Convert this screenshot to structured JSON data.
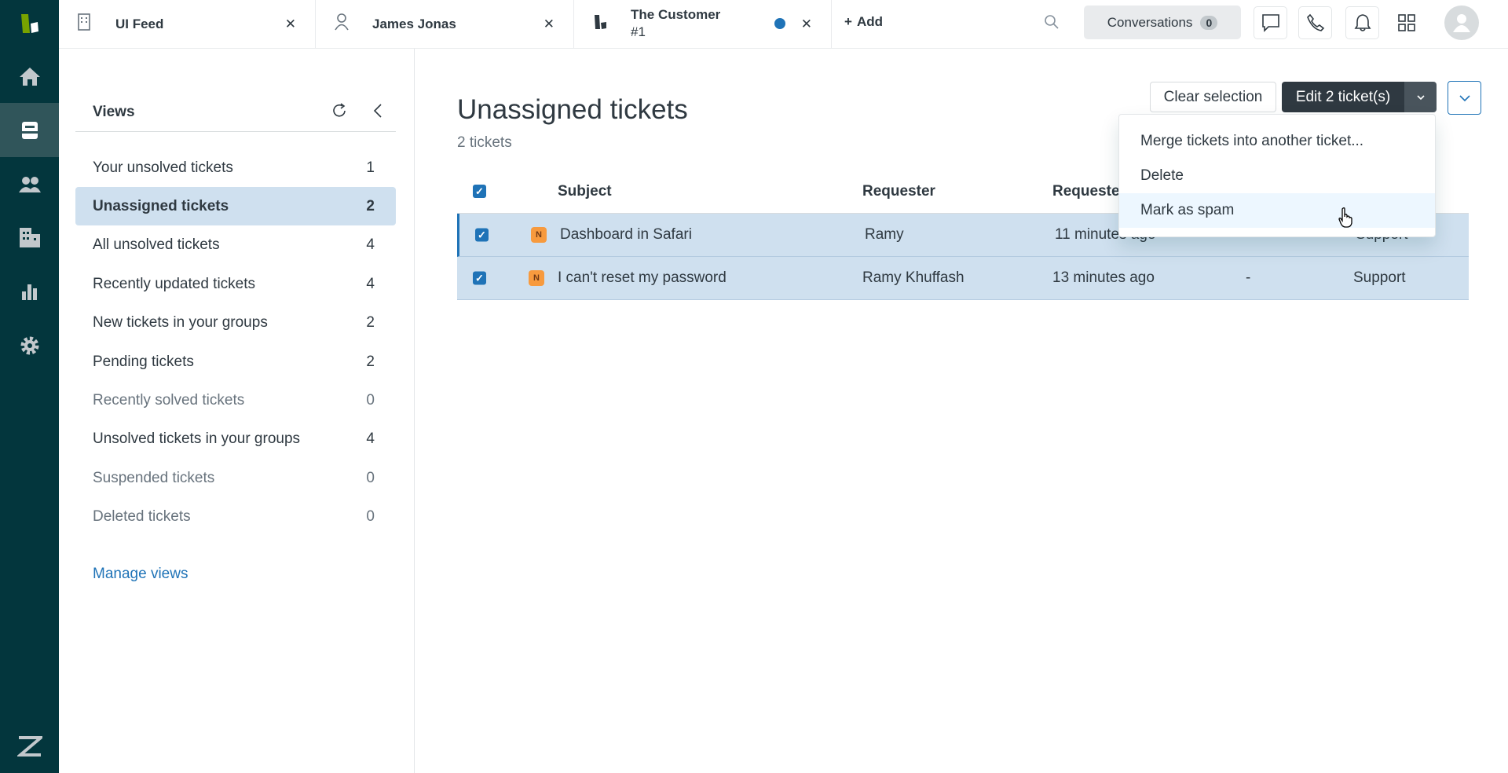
{
  "tabs": [
    {
      "label": "UI Feed",
      "icon": "building-icon"
    },
    {
      "label": "James Jonas",
      "icon": "user-icon"
    },
    {
      "label": "The Customer",
      "sublabel": "#1",
      "icon": "zendesk-icon",
      "unread": true
    }
  ],
  "add_label": "Add",
  "conversations": {
    "label": "Conversations",
    "count": "0"
  },
  "views": {
    "title": "Views",
    "items": [
      {
        "label": "Your unsolved tickets",
        "count": "1"
      },
      {
        "label": "Unassigned tickets",
        "count": "2",
        "selected": true
      },
      {
        "label": "All unsolved tickets",
        "count": "4"
      },
      {
        "label": "Recently updated tickets",
        "count": "4"
      },
      {
        "label": "New tickets in your groups",
        "count": "2"
      },
      {
        "label": "Pending tickets",
        "count": "2"
      },
      {
        "label": "Recently solved tickets",
        "count": "0"
      },
      {
        "label": "Unsolved tickets in your groups",
        "count": "4"
      },
      {
        "label": "Suspended tickets",
        "count": "0"
      },
      {
        "label": "Deleted tickets",
        "count": "0"
      }
    ],
    "manage": "Manage views"
  },
  "main": {
    "title": "Unassigned tickets",
    "count": "2 tickets",
    "clear": "Clear selection",
    "edit": "Edit 2 ticket(s)",
    "columns": [
      "Subject",
      "Requester",
      "Requested"
    ],
    "rows": [
      {
        "status": "N",
        "subject": "Dashboard in Safari",
        "requester": "Ramy",
        "requested": "11 minutes ago",
        "col5": "",
        "group": "Support"
      },
      {
        "status": "N",
        "subject": "I can't reset my password",
        "requester": "Ramy Khuffash",
        "requested": "13 minutes ago",
        "col5": "-",
        "group": "Support"
      }
    ],
    "menu": [
      "Merge tickets into another ticket...",
      "Delete",
      "Mark as spam"
    ]
  },
  "colors": {
    "nav": "#03363d",
    "selected": "#cfe0ef",
    "accent": "#1f73b7",
    "new_badge": "#f79a3e"
  }
}
